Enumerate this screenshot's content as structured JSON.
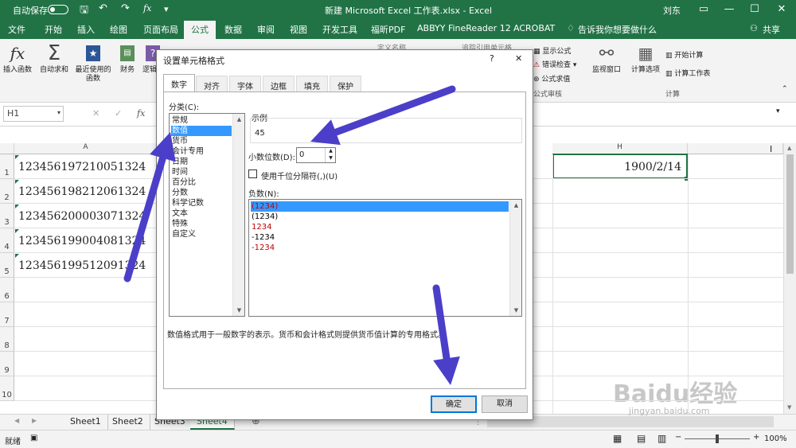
{
  "titlebar": {
    "autosave": "自动保存",
    "toggle_state": "off",
    "title": "新建 Microsoft Excel 工作表.xlsx  -  Excel",
    "user": "刘东",
    "restore_icon": "ribbon-display-icon",
    "fx_icon": "fx"
  },
  "tabs": [
    "文件",
    "开始",
    "插入",
    "绘图",
    "页面布局",
    "公式",
    "数据",
    "审阅",
    "视图",
    "开发工具",
    "福昕PDF",
    "ABBYY FineReader 12",
    "ACROBAT",
    "告诉我你想要做什么"
  ],
  "active_tab": "公式",
  "share": "共享",
  "ribbon": {
    "insert_function": "插入函数",
    "autosum": "自动求和",
    "recent": "最近使用的函数",
    "finance": "财务",
    "logic": "逻辑",
    "show_formulas": "显示公式",
    "error_check": "错误检查",
    "evaluate": "公式求值",
    "formula_audit": "公式审核",
    "watch": "监视窗口",
    "calc_options": "计算选项",
    "calc_now": "开始计算",
    "calc_sheet": "计算工作表",
    "calc_group": "计算",
    "fx_symbol": "fx",
    "sigma": "Σ",
    "trace_partial": "追踪引用单元格",
    "define_partial": "定义名称"
  },
  "namebox": "H1",
  "columns": {
    "a": "A",
    "h": "H"
  },
  "rows": [
    "1",
    "2",
    "3",
    "4",
    "5",
    "6",
    "7",
    "8",
    "9",
    "10"
  ],
  "cells": {
    "a1": "123456197210051324",
    "a2": "123456198212061324",
    "a3": "123456200003071324",
    "a4": "123456199004081324",
    "a5": "123456199512091324",
    "h1": "1900/2/14"
  },
  "sheets": [
    "Sheet1",
    "Sheet2",
    "Sheet3",
    "Sheet4"
  ],
  "active_sheet": "Sheet4",
  "status": {
    "mode": "就绪",
    "zoom": "100%"
  },
  "dialog": {
    "title": "设置单元格格式",
    "help": "?",
    "close": "✕",
    "tabs": [
      "数字",
      "对齐",
      "字体",
      "边框",
      "填充",
      "保护"
    ],
    "active_tab": "数字",
    "category_label": "分类(C):",
    "categories": [
      "常规",
      "数值",
      "货币",
      "会计专用",
      "日期",
      "时间",
      "百分比",
      "分数",
      "科学记数",
      "文本",
      "特殊",
      "自定义"
    ],
    "selected_category": "数值",
    "sample_label": "示例",
    "sample_value": "45",
    "decimals_label": "小数位数(D):",
    "decimals_value": "0",
    "thousands_label": "使用千位分隔符(,)(U)",
    "thousands_checked": false,
    "negative_label": "负数(N):",
    "negatives": [
      {
        "text": "(1234)",
        "color": "#c00000",
        "selected": true
      },
      {
        "text": "(1234)",
        "color": "#000000",
        "selected": false
      },
      {
        "text": "1234",
        "color": "#c00000",
        "selected": false
      },
      {
        "text": "-1234",
        "color": "#000000",
        "selected": false
      },
      {
        "text": "-1234",
        "color": "#c00000",
        "selected": false
      }
    ],
    "description": "数值格式用于一般数字的表示。货币和会计格式则提供货币值计算的专用格式。",
    "ok": "确定",
    "cancel": "取消"
  },
  "watermark": {
    "brand": "Baidu经验",
    "url": "jingyan.baidu.com"
  },
  "colors": {
    "excel_green": "#217346",
    "arrow": "#4b3fc9",
    "select_blue": "#3399ff"
  }
}
